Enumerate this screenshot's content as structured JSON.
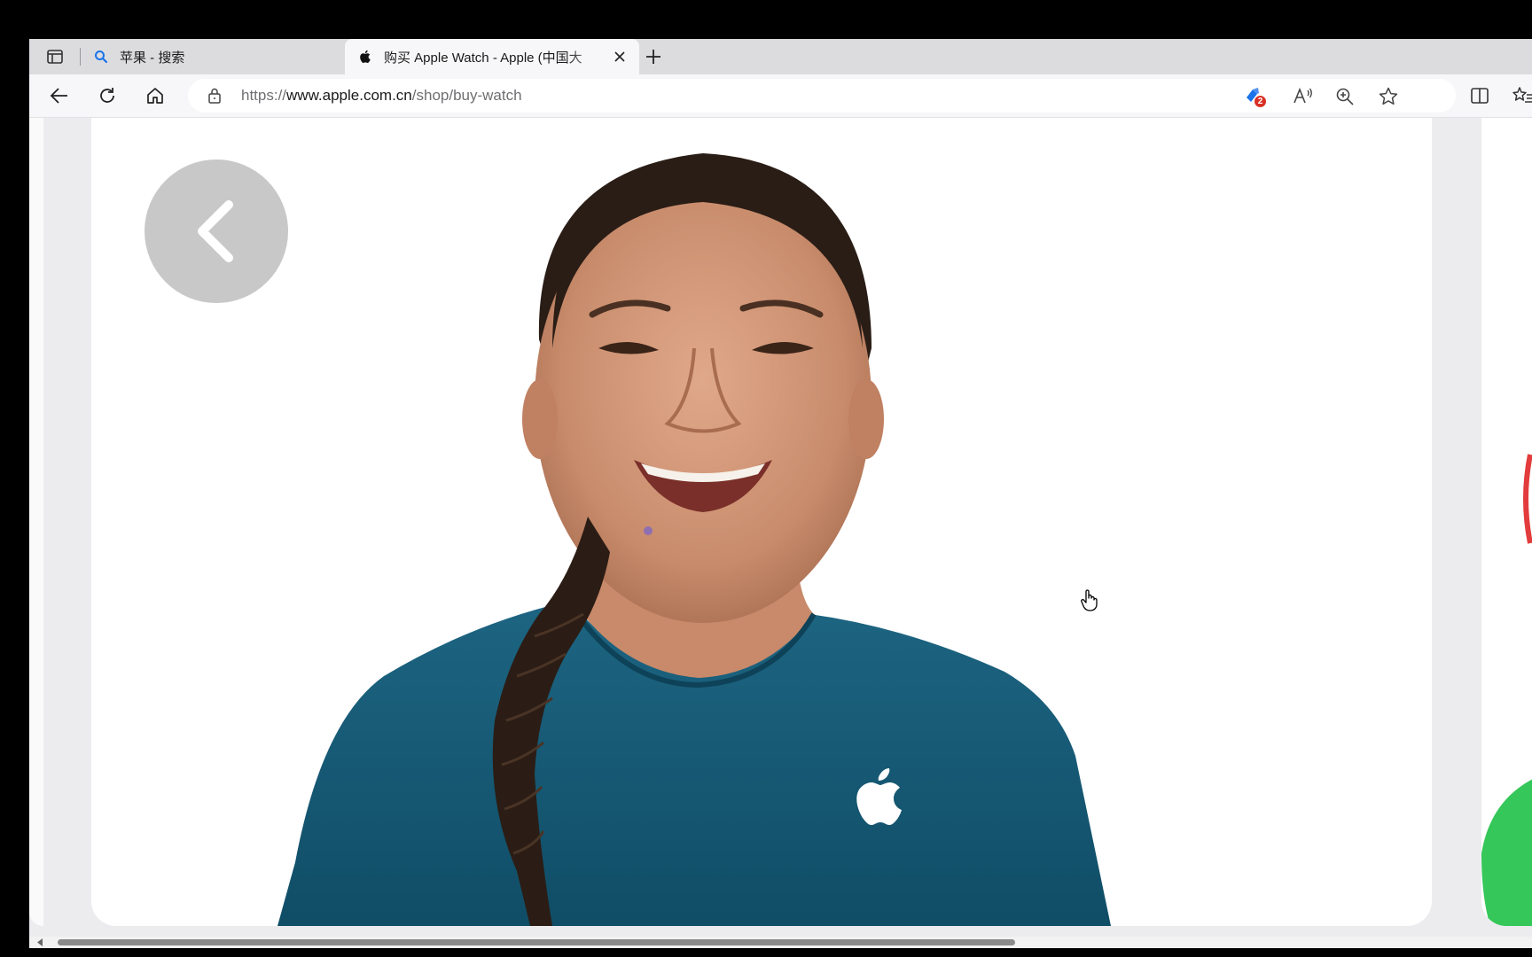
{
  "browser": {
    "tabs": [
      {
        "title": "苹果 - 搜索",
        "favicon": "search-icon",
        "active": false
      },
      {
        "title": "购买 Apple Watch - Apple (中国大",
        "favicon": "apple-logo-icon",
        "active": true
      }
    ],
    "address": {
      "scheme": "https://",
      "host": "www.apple.com.cn",
      "path": "/shop/buy-watch"
    },
    "extension_badge": "2"
  },
  "colors": {
    "shirt": "#175a76",
    "accent_blue": "#1a73e8",
    "badge_red": "#d93025",
    "peek_green": "#35c759"
  }
}
